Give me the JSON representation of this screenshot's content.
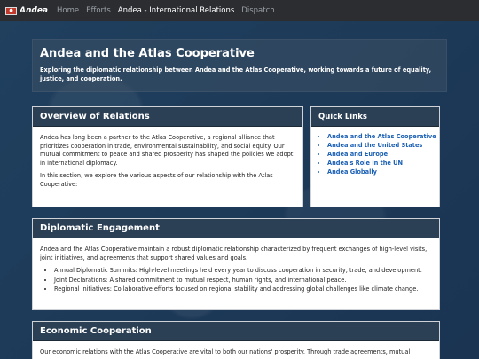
{
  "navbar": {
    "flag_label": "🇦",
    "brand": "Andea",
    "links": [
      "Home",
      "Efforts",
      "Andea - International Relations",
      "Dispatch"
    ]
  },
  "hero": {
    "title": "Andea and the Atlas Cooperative",
    "subtitle": "Exploring the diplomatic relationship between Andea and the Atlas Cooperative, working towards a future of equality, justice, and cooperation."
  },
  "overview": {
    "title": "Overview of Relations",
    "p1": "Andea has long been a partner to the Atlas Cooperative, a regional alliance that prioritizes cooperation in trade, environmental sustainability, and social equity. Our mutual commitment to peace and shared prosperity has shaped the policies we adopt in international diplomacy.",
    "p2": "In this section, we explore the various aspects of our relationship with the Atlas Cooperative:"
  },
  "quick_links": {
    "title": "Quick Links",
    "items": [
      "Andea and the Atlas Cooperative",
      "Andea and the United States",
      "Andea and Europe",
      "Andea's Role in the UN",
      "Andea Globally"
    ]
  },
  "diplomatic": {
    "title": "Diplomatic Engagement",
    "intro": "Andea and the Atlas Cooperative maintain a robust diplomatic relationship characterized by frequent exchanges of high-level visits, joint initiatives, and agreements that support shared values and goals.",
    "items": [
      "Annual Diplomatic Summits: High-level meetings held every year to discuss cooperation in security, trade, and development.",
      "Joint Declarations: A shared commitment to mutual respect, human rights, and international peace.",
      "Regional Initiatives: Collaborative efforts focused on regional stability and addressing global challenges like climate change."
    ]
  },
  "economic": {
    "title": "Economic Cooperation",
    "intro": "Our economic relations with the Atlas Cooperative are vital to both our nations' prosperity. Through trade agreements, mutual"
  }
}
